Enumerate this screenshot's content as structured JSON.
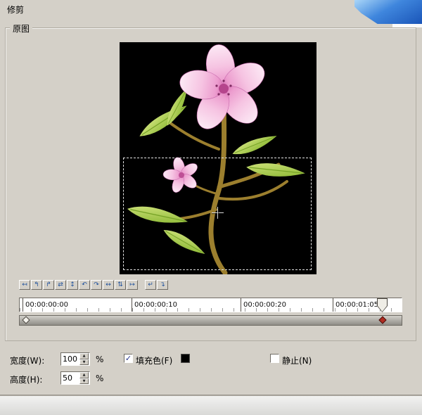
{
  "window": {
    "title": "修剪"
  },
  "group": {
    "label": "原图"
  },
  "toolbar": {
    "buttons": [
      {
        "name": "move-left",
        "glyph": "↤"
      },
      {
        "name": "rotate-left",
        "glyph": "↰"
      },
      {
        "name": "rotate-right",
        "glyph": "↱"
      },
      {
        "name": "swap-horizontal",
        "glyph": "⇄"
      },
      {
        "name": "resize-vertical",
        "glyph": "↕"
      },
      {
        "name": "undo",
        "glyph": "↶"
      },
      {
        "name": "redo",
        "glyph": "↷"
      },
      {
        "name": "resize-horizontal",
        "glyph": "↔"
      },
      {
        "name": "swap-vertical",
        "glyph": "⇅"
      },
      {
        "name": "move-right",
        "glyph": "↦"
      }
    ],
    "buttons2": [
      {
        "name": "enter",
        "glyph": "↵"
      },
      {
        "name": "down-turn",
        "glyph": "↴"
      }
    ]
  },
  "timeline": {
    "labels": [
      "00:00:00:00",
      "00:00:00:10",
      "00:00:00:20",
      "00:00:01:05"
    ]
  },
  "controls": {
    "width_label": "宽度(W):",
    "width_value": "100",
    "width_unit": "%",
    "height_label": "高度(H):",
    "height_value": "50",
    "height_unit": "%",
    "fill_label": "填充色(F)",
    "fill_checkmark": "✓",
    "fill_color": "#000000",
    "still_label": "静止(N)",
    "spin_up_glyph": "▲",
    "spin_down_glyph": "▼"
  },
  "colors": {
    "timeline_marker": "#b02c22",
    "toolbar_icon": "#1d4f9c"
  }
}
